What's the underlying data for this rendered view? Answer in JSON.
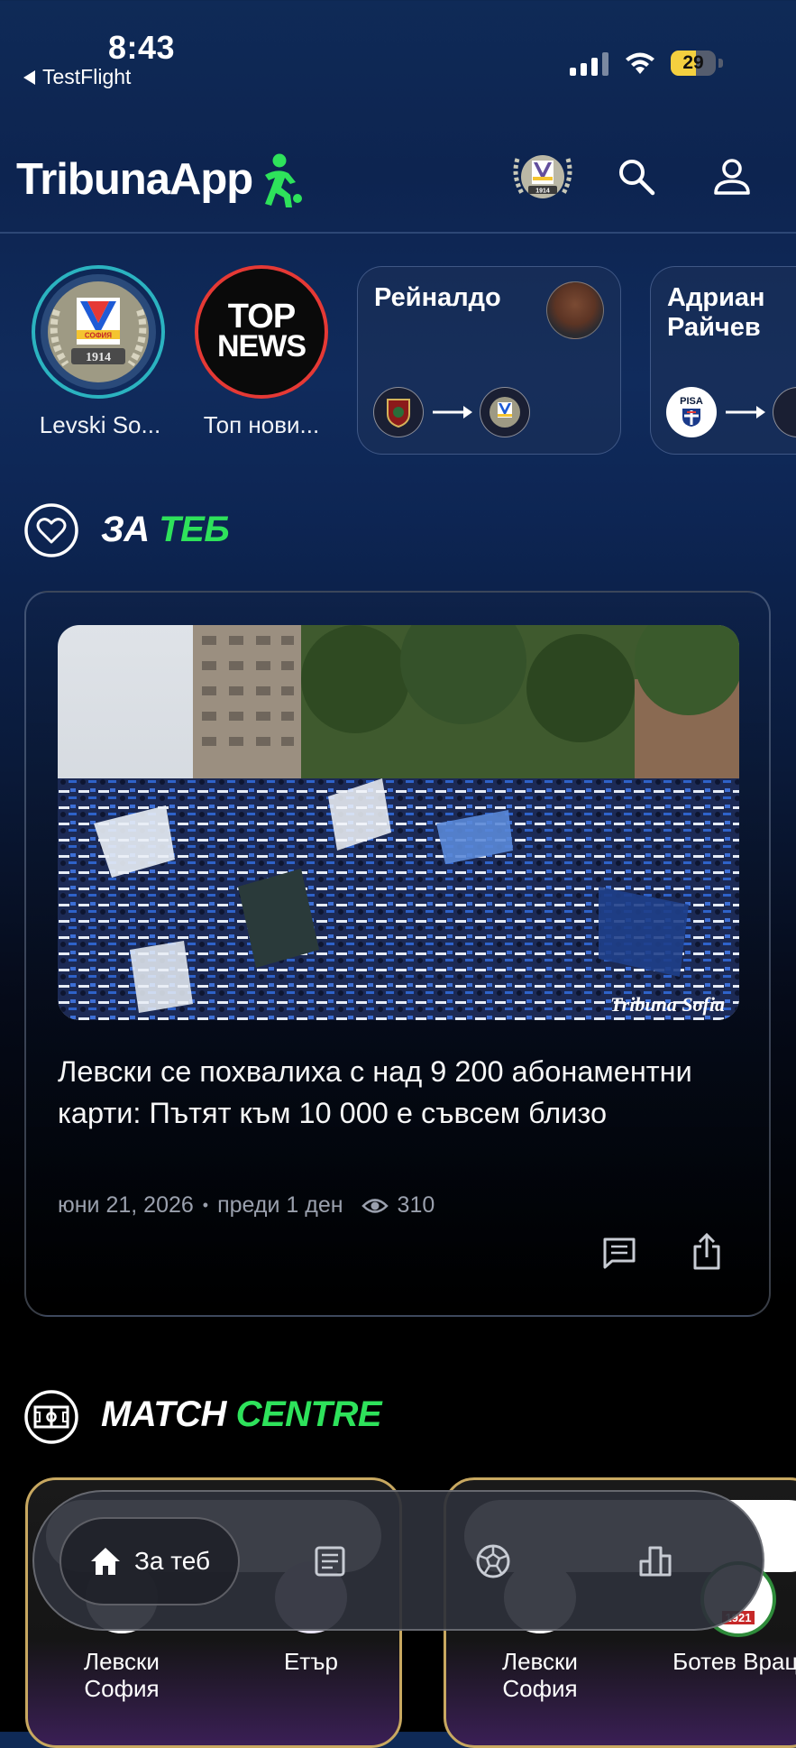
{
  "status_bar": {
    "time": "8:43",
    "back_app": "TestFlight",
    "battery": "29"
  },
  "header": {
    "logo_main": "TribunaApp",
    "icons": [
      "team-crest-icon",
      "search-icon",
      "user-icon"
    ]
  },
  "stories": [
    {
      "label": "Levski So...",
      "ring_color": "#2bb3c0"
    },
    {
      "label": "Топ нови...",
      "ring_color": "#e53935",
      "badge_line1": "TOP",
      "badge_line2": "NEWS"
    }
  ],
  "transfers": [
    {
      "name": "Рейналдо"
    },
    {
      "name_line1": "Адриан",
      "name_line2": "Райчев",
      "from_label": "PISA"
    }
  ],
  "for_you": {
    "title_white": "ЗА",
    "title_green": "ТЕБ"
  },
  "article": {
    "photo_watermark": "Tribuna Sofia",
    "headline": "Левски се похвалиха с над 9 200 абонаментни карти: Пътят към 10 000 е съвсем близо",
    "date": "юни 21, 2026",
    "separator": "•",
    "relative": "преди 1 ден",
    "views": "310"
  },
  "match_centre": {
    "title_white": "MATCH",
    "title_green": "CENTRE",
    "matches": [
      {
        "home_line1": "Левски",
        "home_line2": "София",
        "away": "Етър"
      },
      {
        "home_line1": "Левски",
        "home_line2": "София",
        "away": "Ботев Враца",
        "away_year": "1921"
      }
    ]
  },
  "tabbar": {
    "active_label": "За теб",
    "tabs": [
      "home-icon",
      "news-icon",
      "football-icon",
      "standings-icon"
    ]
  },
  "colors": {
    "accent_green": "#2ee25b",
    "levski_blue": "#1e5bd6",
    "card_gold": "#c8a860"
  }
}
